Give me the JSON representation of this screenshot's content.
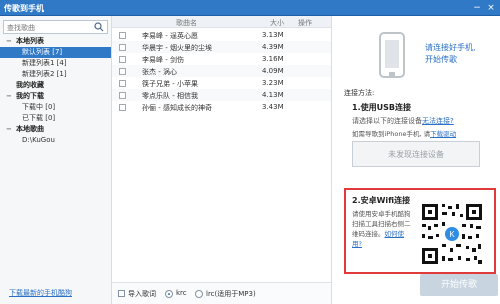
{
  "window": {
    "title": "传歌到手机",
    "min_icon": "minimize-icon",
    "close_icon": "close-icon"
  },
  "left": {
    "search_placeholder": "查找歌曲",
    "tree": [
      {
        "type": "section",
        "label": "本地列表",
        "toggle": "−"
      },
      {
        "type": "child",
        "label": "默认列表 [7]",
        "selected": true
      },
      {
        "type": "child",
        "label": "新建列表1 [4]"
      },
      {
        "type": "child",
        "label": "新建列表2 [1]"
      },
      {
        "type": "section",
        "label": "我的收藏",
        "toggle": ""
      },
      {
        "type": "section",
        "label": "我的下载",
        "toggle": "−"
      },
      {
        "type": "child",
        "label": "下载中 [0]"
      },
      {
        "type": "child",
        "label": "已下载 [0]"
      },
      {
        "type": "section",
        "label": "本地歌曲",
        "toggle": "−"
      },
      {
        "type": "child",
        "label": "D:\\KuGou"
      }
    ],
    "download_link": "下载最新的手机酷狗"
  },
  "middle": {
    "headers": {
      "name": "歌曲名",
      "size": "大小",
      "action": "操作"
    },
    "rows": [
      {
        "name": "李易峰 - 逞英心愿",
        "size": "3.13M"
      },
      {
        "name": "华晨宇 - 烟火里的尘埃",
        "size": "4.39M"
      },
      {
        "name": "李易峰 - 剑伤",
        "size": "3.16M"
      },
      {
        "name": "张杰 - 涡心",
        "size": "4.09M"
      },
      {
        "name": "筷子兄弟 - 小苹果",
        "size": "3.23M"
      },
      {
        "name": "零点乐队 - 相信我",
        "size": "4.13M"
      },
      {
        "name": "孙俪 - 感知成长的神奇",
        "size": "3.43M"
      }
    ],
    "bottom": {
      "import_lyric": "导入歌词",
      "krc": "krc",
      "lrc": "lrc(适用于MP3)"
    }
  },
  "right": {
    "connect_title_line1": "请连接好手机,",
    "connect_title_line2": "开始传歌",
    "methods": "连接方法:",
    "usb_title": "1.使用USB连接",
    "usb_text": "请选择以下的连接设备",
    "usb_link": "无法连接?",
    "iphone_prefix": "如需导歌到iPhone手机, 请",
    "iphone_link": "下载驱动",
    "no_device": "未发现连接设备",
    "wifi_title": "2.安卓Wifi连接",
    "wifi_text": "请使用安卓手机酷狗扫描工具扫描右侧二维码连接。",
    "wifi_link": "如何使用?",
    "start_button": "开始传歌"
  }
}
